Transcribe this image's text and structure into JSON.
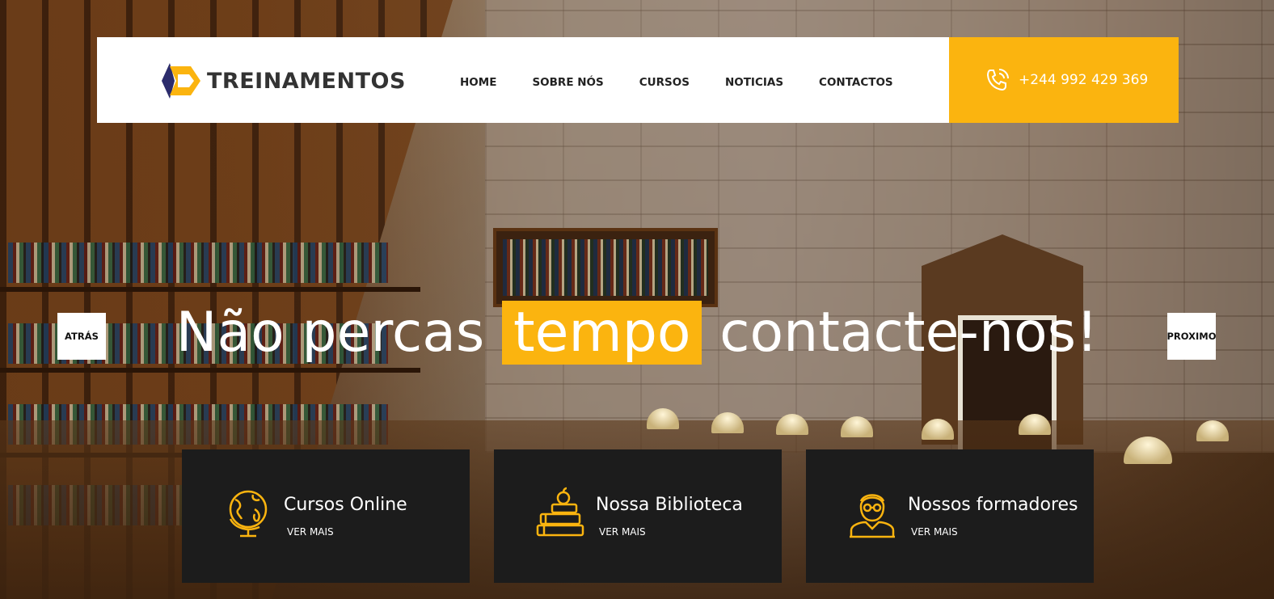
{
  "brand": {
    "name": "TREINAMENTOS",
    "accent": "#fbb40f",
    "logo_dark": "#2c2c6c"
  },
  "nav": {
    "items": [
      {
        "label": "HOME"
      },
      {
        "label": "SOBRE NÓS"
      },
      {
        "label": "CURSOS"
      },
      {
        "label": "NOTICIAS"
      },
      {
        "label": "CONTACTOS"
      }
    ]
  },
  "contact": {
    "phone": "+244 992 429 369",
    "icon": "phone-icon"
  },
  "hero": {
    "headline_before": "Não percas",
    "headline_highlight": "tempo",
    "headline_after": "contacte-nos!",
    "prev_label": "ATRÁS",
    "next_label": "PROXIMO"
  },
  "features": [
    {
      "title": "Cursos Online",
      "link": "VER MAIS",
      "icon": "globe-icon"
    },
    {
      "title": "Nossa Biblioteca",
      "link": "VER MAIS",
      "icon": "books-icon"
    },
    {
      "title": "Nossos formadores",
      "link": "VER MAIS",
      "icon": "teacher-icon"
    }
  ]
}
